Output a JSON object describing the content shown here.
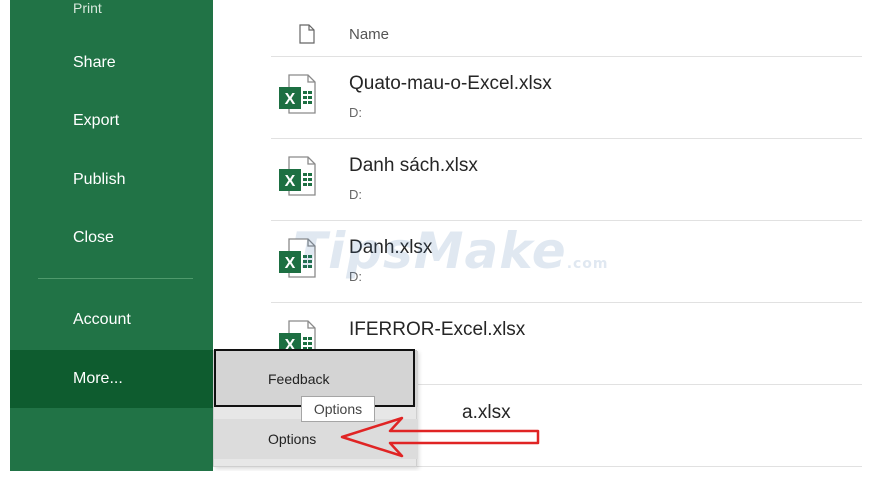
{
  "sidebar": {
    "items": [
      {
        "label": "Print"
      },
      {
        "label": "Share"
      },
      {
        "label": "Export"
      },
      {
        "label": "Publish"
      },
      {
        "label": "Close"
      },
      {
        "label": "Account"
      },
      {
        "label": "More..."
      }
    ]
  },
  "file_list": {
    "header_label": "Name",
    "files": [
      {
        "name": "Quato-mau-o-Excel.xlsx",
        "path": "D:"
      },
      {
        "name": "Danh sách.xlsx",
        "path": "D:"
      },
      {
        "name": "Danh.xlsx",
        "path": "D:"
      },
      {
        "name": "IFERROR-Excel.xlsx",
        "path": ""
      },
      {
        "name": "a.xlsx",
        "path": ""
      }
    ]
  },
  "popup_menu": {
    "items": [
      {
        "label": "Feedback"
      },
      {
        "label": "Options"
      }
    ]
  },
  "tooltip": {
    "text": "Options"
  },
  "watermark": {
    "text": "TipsMake",
    "suffix": ".com"
  },
  "colors": {
    "sidebar_bg": "#217346",
    "sidebar_selected": "#0e5c2f",
    "annotation_red": "#e02424",
    "excel_green": "#1d6f42"
  }
}
